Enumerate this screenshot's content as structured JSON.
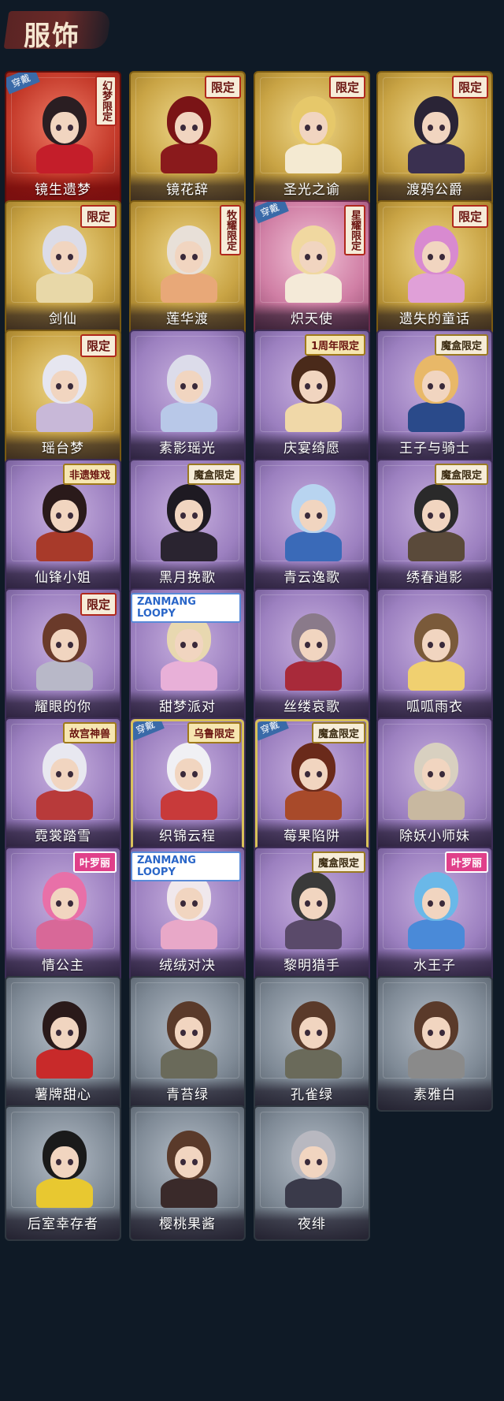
{
  "page": {
    "title": "服饰"
  },
  "colors": {
    "gold": "#c9a445",
    "red": "#c43a2a",
    "pink": "#d07fa5",
    "purple": "#9c80c0",
    "gray": "#7f8a96",
    "badge_red": "#b0281c",
    "equip_blue": "#3a6aa8",
    "background": "#0f1a26"
  },
  "costumes": [
    {
      "name": "镜生遗梦",
      "tier": "red",
      "badge": "幻梦限定",
      "badge_style": "vertical",
      "equipped_label": "穿戴",
      "hair": "#2a1e22",
      "outfit": "#c41e2a"
    },
    {
      "name": "镜花辞",
      "tier": "gold",
      "badge": "限定",
      "badge_style": "",
      "hair": "#7a1416",
      "outfit": "#8a1a1c"
    },
    {
      "name": "圣光之谕",
      "tier": "gold",
      "badge": "限定",
      "badge_style": "",
      "hair": "#e6c86a",
      "outfit": "#f4ead2"
    },
    {
      "name": "渡鸦公爵",
      "tier": "gold",
      "badge": "限定",
      "badge_style": "",
      "hair": "#2a2436",
      "outfit": "#3a3050"
    },
    {
      "name": "剑仙",
      "tier": "gold",
      "badge": "限定",
      "badge_style": "",
      "hair": "#dcdce8",
      "outfit": "#e8d8a8"
    },
    {
      "name": "莲华渡",
      "tier": "gold",
      "badge": "牧耀限定",
      "badge_style": "vertical",
      "hair": "#e8e0d8",
      "outfit": "#e8a878"
    },
    {
      "name": "炽天使",
      "tier": "pink",
      "badge": "星耀限定",
      "badge_style": "vertical",
      "equipped_label": "穿戴",
      "hair": "#f0d8a0",
      "outfit": "#f4ead8"
    },
    {
      "name": "遗失的童话",
      "tier": "gold",
      "badge": "限定",
      "badge_style": "",
      "hair": "#d88ad0",
      "outfit": "#e0a0d8"
    },
    {
      "name": "瑶台梦",
      "tier": "gold",
      "badge": "限定",
      "badge_style": "",
      "hair": "#e6e6f0",
      "outfit": "#c8b8d8"
    },
    {
      "name": "素影瑶光",
      "tier": "purple",
      "badge": "",
      "badge_style": "",
      "hair": "#dcdcea",
      "outfit": "#b8c8e8"
    },
    {
      "name": "庆宴绮愿",
      "tier": "purple",
      "badge": "1周年限定",
      "badge_style": "gold",
      "hair": "#4a2a1a",
      "outfit": "#f0d8a8"
    },
    {
      "name": "王子与骑士",
      "tier": "purple",
      "badge": "魔盒限定",
      "badge_style": "box",
      "hair": "#e8b868",
      "outfit": "#2a4a8a"
    },
    {
      "name": "仙锋小姐",
      "tier": "purple",
      "badge": "非遗雉戏",
      "badge_style": "gold",
      "hair": "#2a1a1a",
      "outfit": "#a83a2a"
    },
    {
      "name": "黑月挽歌",
      "tier": "purple",
      "badge": "魔盒限定",
      "badge_style": "box",
      "hair": "#1e1a22",
      "outfit": "#2a2430"
    },
    {
      "name": "青云逸歌",
      "tier": "purple",
      "badge": "",
      "badge_style": "",
      "hair": "#b8d4f0",
      "outfit": "#3a6ab8"
    },
    {
      "name": "绣春逍影",
      "tier": "purple",
      "badge": "魔盒限定",
      "badge_style": "box",
      "hair": "#2a2a2a",
      "outfit": "#5a4a3a"
    },
    {
      "name": "耀眼的你",
      "tier": "purple",
      "badge": "限定",
      "badge_style": "",
      "hair": "#6a3a2a",
      "outfit": "#b8b8c8"
    },
    {
      "name": "甜梦派对",
      "tier": "purple",
      "badge": "ZANMANG LOOPY",
      "badge_style": "loopy",
      "hair": "#e8d8b0",
      "outfit": "#e8b0d8"
    },
    {
      "name": "丝缕哀歌",
      "tier": "purple",
      "badge": "",
      "badge_style": "",
      "hair": "#8a7a8a",
      "outfit": "#a82a3a"
    },
    {
      "name": "呱呱雨衣",
      "tier": "purple",
      "badge": "",
      "badge_style": "",
      "hair": "#7a5a3a",
      "outfit": "#f0d070"
    },
    {
      "name": "霓裳踏雪",
      "tier": "purple",
      "badge": "故宫神兽",
      "badge_style": "gold",
      "hair": "#e8e8f0",
      "outfit": "#b83a3a"
    },
    {
      "name": "织锦云程",
      "tier": "purple",
      "badge": "乌鲁限定",
      "badge_style": "gold",
      "equipped_label": "穿戴",
      "selected": true,
      "hair": "#f0f0f4",
      "outfit": "#c83a3a"
    },
    {
      "name": "莓果陷阱",
      "tier": "purple",
      "badge": "魔盒限定",
      "badge_style": "box",
      "equipped_label": "穿戴",
      "selected": true,
      "hair": "#6a2a1a",
      "outfit": "#a84a2a"
    },
    {
      "name": "除妖小师妹",
      "tier": "purple",
      "badge": "",
      "badge_style": "",
      "hair": "#d8d0c0",
      "outfit": "#c8b8a0"
    },
    {
      "name": "情公主",
      "tier": "purple",
      "badge": "叶罗丽",
      "badge_style": "pink",
      "hair": "#e870a8",
      "outfit": "#d86898"
    },
    {
      "name": "绒绒对决",
      "tier": "purple",
      "badge": "ZANMANG LOOPY",
      "badge_style": "loopy",
      "hair": "#f0e8ec",
      "outfit": "#e8a8c8"
    },
    {
      "name": "黎明猎手",
      "tier": "purple",
      "badge": "魔盒限定",
      "badge_style": "box",
      "hair": "#3a3a3a",
      "outfit": "#5a4a6a"
    },
    {
      "name": "水王子",
      "tier": "purple",
      "badge": "叶罗丽",
      "badge_style": "pink",
      "hair": "#6ab8e8",
      "outfit": "#4a8ad8"
    },
    {
      "name": "薯牌甜心",
      "tier": "gray",
      "badge": "",
      "badge_style": "",
      "hair": "#2a1a1a",
      "outfit": "#c82a2a"
    },
    {
      "name": "青苔绿",
      "tier": "gray",
      "badge": "",
      "badge_style": "",
      "hair": "#5a3a2a",
      "outfit": "#6a6a5a"
    },
    {
      "name": "孔雀绿",
      "tier": "gray",
      "badge": "",
      "badge_style": "",
      "hair": "#5a3a2a",
      "outfit": "#6a6a5a"
    },
    {
      "name": "素雅白",
      "tier": "gray",
      "badge": "",
      "badge_style": "",
      "hair": "#5a3a2a",
      "outfit": "#8a8a8a"
    },
    {
      "name": "后室幸存者",
      "tier": "gray",
      "badge": "",
      "badge_style": "",
      "hair": "#1a1a1a",
      "outfit": "#e8c830"
    },
    {
      "name": "樱桃果酱",
      "tier": "gray",
      "badge": "",
      "badge_style": "",
      "hair": "#5a3a2a",
      "outfit": "#3a2a2a"
    },
    {
      "name": "夜绯",
      "tier": "gray",
      "badge": "",
      "badge_style": "",
      "hair": "#b8b8c0",
      "outfit": "#3a3a4a"
    }
  ]
}
